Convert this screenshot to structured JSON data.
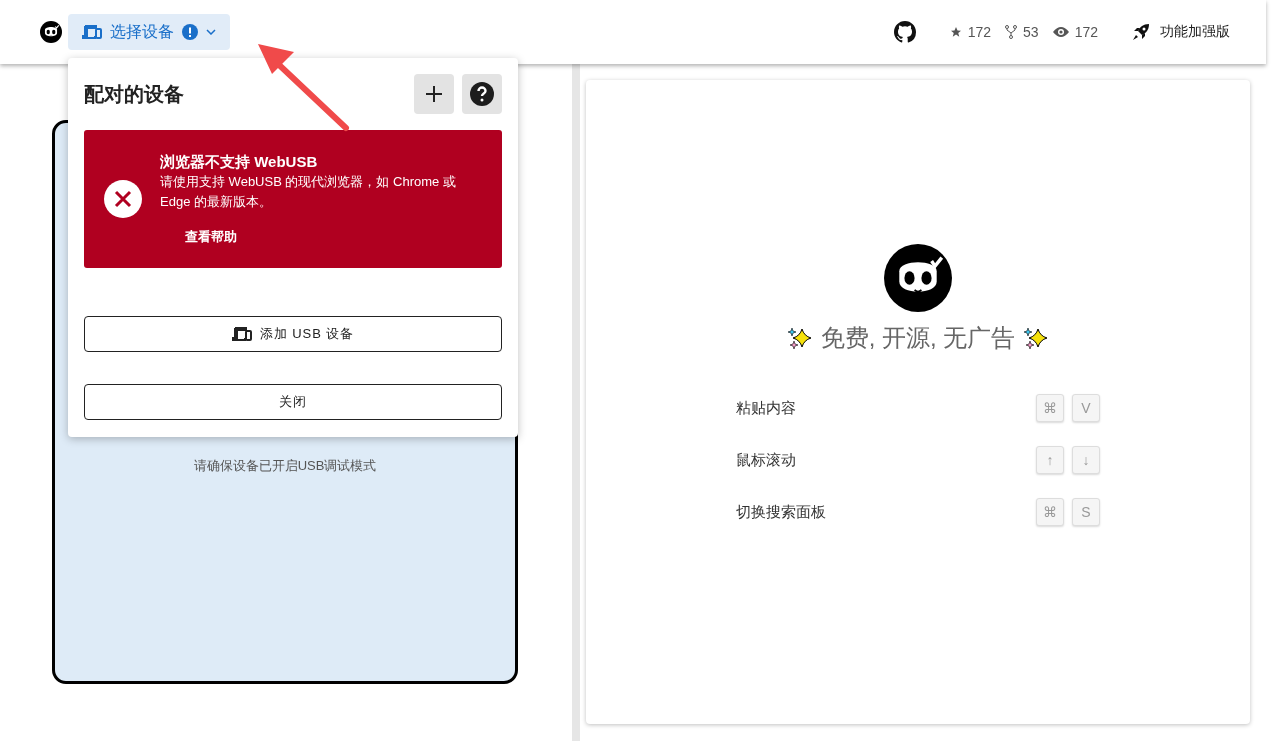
{
  "header": {
    "device_button": {
      "label": "选择设备",
      "warning": true
    },
    "stats": [
      {
        "kind": "star",
        "value": "172"
      },
      {
        "kind": "fork",
        "value": "53"
      },
      {
        "kind": "watch",
        "value": "172"
      }
    ],
    "enhanced": "功能加强版"
  },
  "device_panel": {
    "hint": "请确保设备已开启USB调试模式"
  },
  "popover": {
    "title": "配对的设备",
    "error": {
      "title": "浏览器不支持 WebUSB",
      "message": "请使用支持 WebUSB 的现代浏览器，如 Chrome 或 Edge 的最新版本。",
      "link": "查看帮助"
    },
    "add_button": "添加 USB 设备",
    "close_button": "关闭"
  },
  "welcome": {
    "tagline": "免费, 开源, 无广告",
    "shortcuts": [
      {
        "label": "粘贴内容",
        "keys": [
          "⌘",
          "V"
        ]
      },
      {
        "label": "鼠标滚动",
        "keys": [
          "↑",
          "↓"
        ]
      },
      {
        "label": "切换搜索面板",
        "keys": [
          "⌘",
          "S"
        ]
      }
    ]
  }
}
